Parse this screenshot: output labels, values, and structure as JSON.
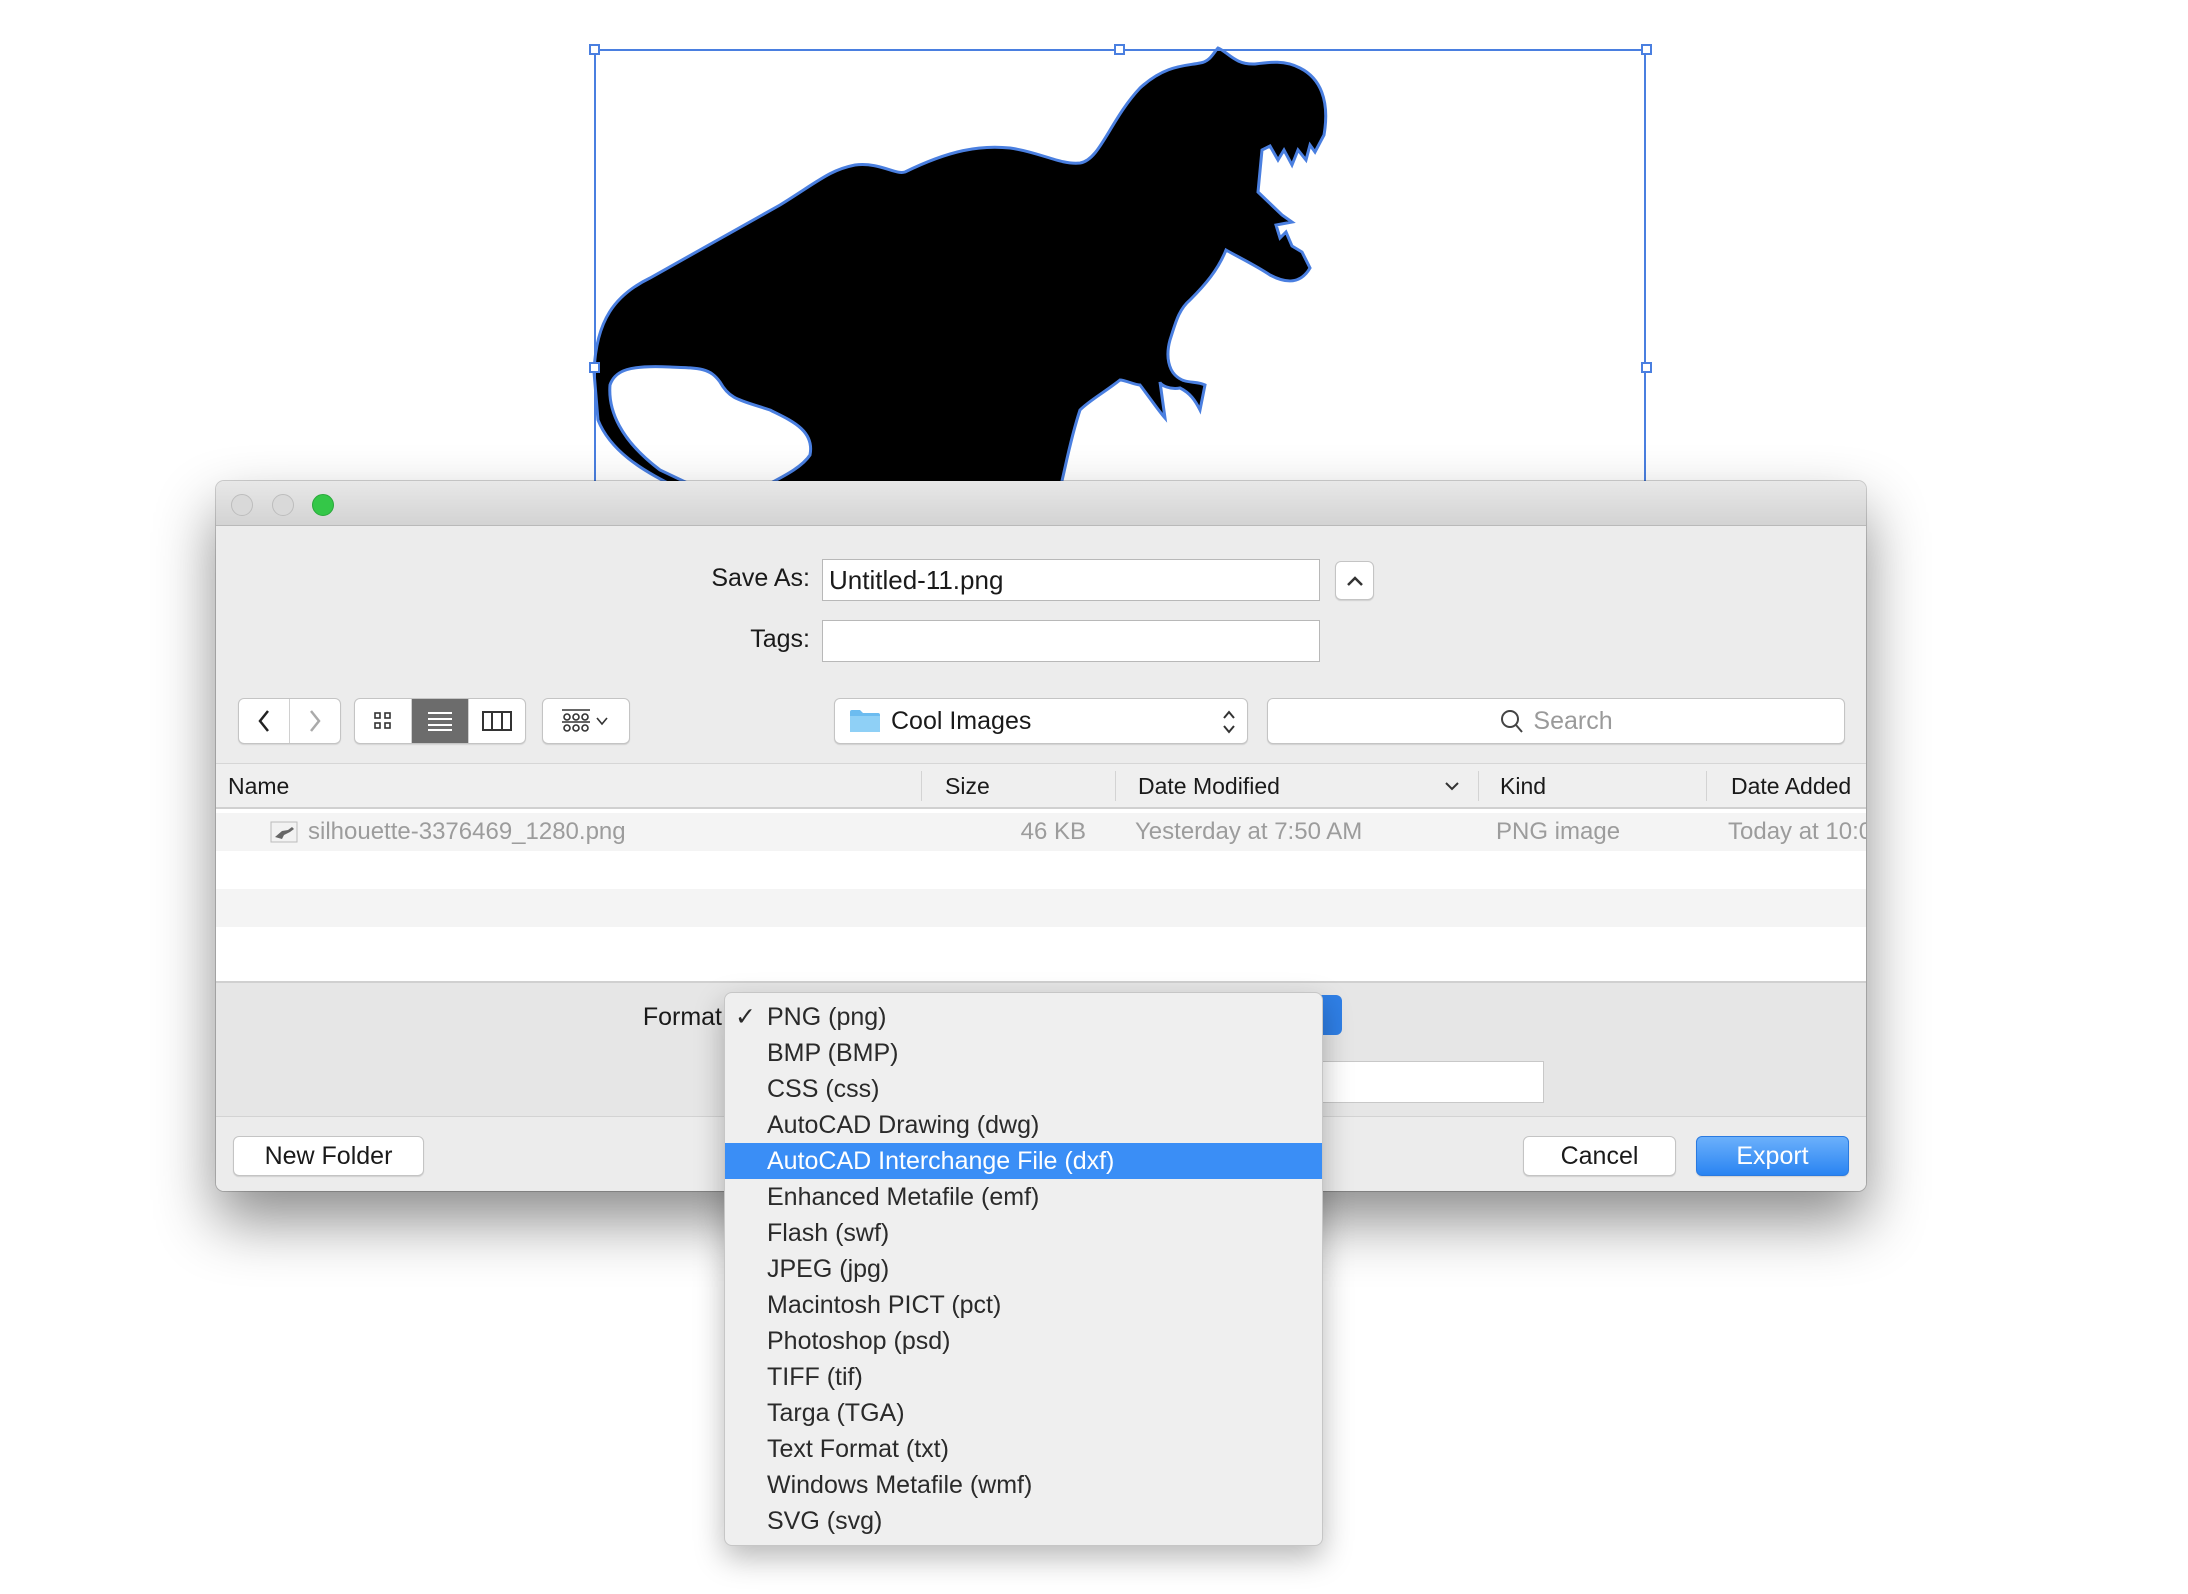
{
  "canvas": {
    "artwork": "t-rex-silhouette",
    "selection": "bounding-box-selected"
  },
  "dialog": {
    "window_controls": [
      "close",
      "minimize",
      "zoom"
    ],
    "save_as": {
      "label": "Save As:",
      "value": "Untitled-11.png"
    },
    "tags": {
      "label": "Tags:",
      "value": ""
    },
    "toolbar": {
      "back_icon": "chevron-left-icon",
      "forward_icon": "chevron-right-icon",
      "views": [
        "icon-view",
        "list-view",
        "column-view"
      ],
      "active_view": "list-view",
      "group_icon": "arrange-icon",
      "location": "Cool Images",
      "search_placeholder": "Search"
    },
    "columns": [
      "Name",
      "Size",
      "Date Modified",
      "Kind",
      "Date Added"
    ],
    "sort_column": "Date Modified",
    "files": [
      {
        "name": "silhouette-3376469_1280.png",
        "size": "46 KB",
        "date_modified": "Yesterday at 7:50 AM",
        "kind": "PNG image",
        "date_added": "Today at 10:0"
      }
    ],
    "format": {
      "label": "Format"
    },
    "buttons": {
      "new_folder": "New Folder",
      "cancel": "Cancel",
      "export": "Export"
    }
  },
  "format_menu": {
    "selected": "PNG (png)",
    "highlighted": "AutoCAD Interchange File (dxf)",
    "check": "✓",
    "items": [
      "PNG (png)",
      "BMP (BMP)",
      "CSS (css)",
      "AutoCAD Drawing (dwg)",
      "AutoCAD Interchange File (dxf)",
      "Enhanced Metafile (emf)",
      "Flash (swf)",
      "JPEG (jpg)",
      "Macintosh PICT (pct)",
      "Photoshop (psd)",
      "TIFF (tif)",
      "Targa (TGA)",
      "Text Format (txt)",
      "Windows Metafile (wmf)",
      "SVG (svg)"
    ]
  },
  "colors": {
    "accent": "#3a8ef6",
    "selection": "#4a7fe0",
    "close_light": "#d9d9d9",
    "zoom_light": "#34c748"
  }
}
